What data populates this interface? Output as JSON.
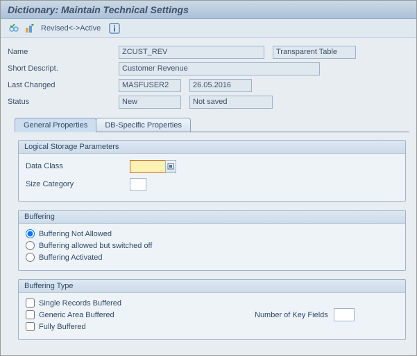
{
  "title": "Dictionary: Maintain Technical Settings",
  "toolbar": {
    "revised_active_label": "Revised<->Active"
  },
  "header": {
    "name_label": "Name",
    "name_value": "ZCUST_REV",
    "type_value": "Transparent Table",
    "shortdesc_label": "Short Descript.",
    "shortdesc_value": "Customer Revenue",
    "lastchanged_label": "Last Changed",
    "lastchanged_user": "MASFUSER2",
    "lastchanged_date": "26.05.2016",
    "status_label": "Status",
    "status_value": "New",
    "saved_value": "Not saved"
  },
  "tabs": {
    "general": "General Properties",
    "dbspecific": "DB-Specific Properties"
  },
  "logstor": {
    "title": "Logical Storage Parameters",
    "dataclass_label": "Data Class",
    "dataclass_value": "",
    "sizecat_label": "Size Category",
    "sizecat_value": ""
  },
  "buffering": {
    "title": "Buffering",
    "opt_not_allowed": "Buffering Not Allowed",
    "opt_allowed_off": "Buffering allowed but switched off",
    "opt_activated": "Buffering Activated",
    "selected": "not_allowed"
  },
  "buftype": {
    "title": "Buffering Type",
    "single": "Single Records Buffered",
    "generic": "Generic Area Buffered",
    "nkf_label": "Number of Key Fields",
    "nkf_value": "",
    "fully": "Fully Buffered"
  }
}
